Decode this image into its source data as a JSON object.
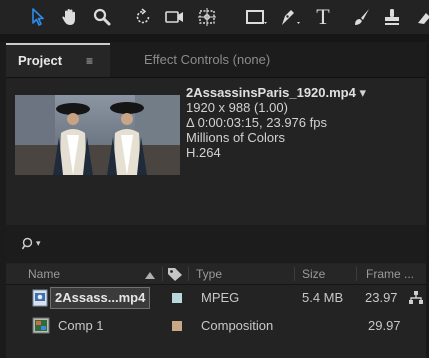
{
  "toolbar": {
    "tools": [
      "selection-tool-icon",
      "hand-tool-icon",
      "zoom-tool-icon",
      "rotation-tool-icon",
      "camera-tool-icon",
      "pan-behind-tool-icon",
      "rectangle-tool-icon",
      "pen-tool-icon",
      "type-tool-icon",
      "brush-tool-icon",
      "clone-stamp-tool-icon"
    ],
    "type_glyph": "T"
  },
  "tabs": {
    "project": "Project",
    "project_menu": "≡",
    "effect_controls": "Effect Controls (none)"
  },
  "file_info": {
    "name": "2AssassinsParis_1920.mp4",
    "dropdown": "▾",
    "dimensions": "1920 x 988 (1.00)",
    "duration": "Δ 0:00:03:15, 23.976 fps",
    "colors": "Millions of Colors",
    "codec": "H.264"
  },
  "search": {
    "arrow": "▾"
  },
  "columns": {
    "name": "Name",
    "type": "Type",
    "size": "Size",
    "frame_rate": "Frame ..."
  },
  "items": [
    {
      "name": "2Assass...mp4",
      "label_color": "#b9d8dc",
      "type": "MPEG",
      "size": "5.4 MB",
      "frame_rate": "23.97"
    },
    {
      "name": "Comp 1",
      "label_color": "#c8a886",
      "type": "Composition",
      "size": "",
      "frame_rate": "29.97"
    }
  ],
  "colors": {
    "accent": "#2d8ceb"
  }
}
